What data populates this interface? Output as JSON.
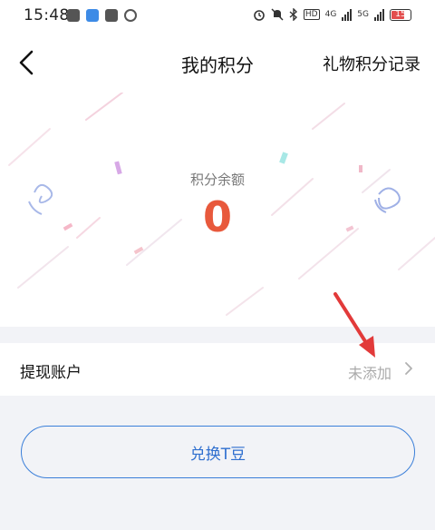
{
  "status_bar": {
    "time": "15:48",
    "network_label_1": "4G",
    "network_label_2": "5G",
    "hd_label": "HD",
    "battery_level": "15"
  },
  "nav": {
    "title": "我的积分",
    "right_link": "礼物积分记录"
  },
  "balance": {
    "label": "积分余额",
    "value": "0"
  },
  "withdraw_account": {
    "label": "提现账户",
    "status": "未添加"
  },
  "exchange_button": {
    "label": "兑换T豆"
  },
  "colors": {
    "accent_blue": "#2f6fcf",
    "balance_red": "#e8593c",
    "annotation_red": "#e23a3a"
  }
}
